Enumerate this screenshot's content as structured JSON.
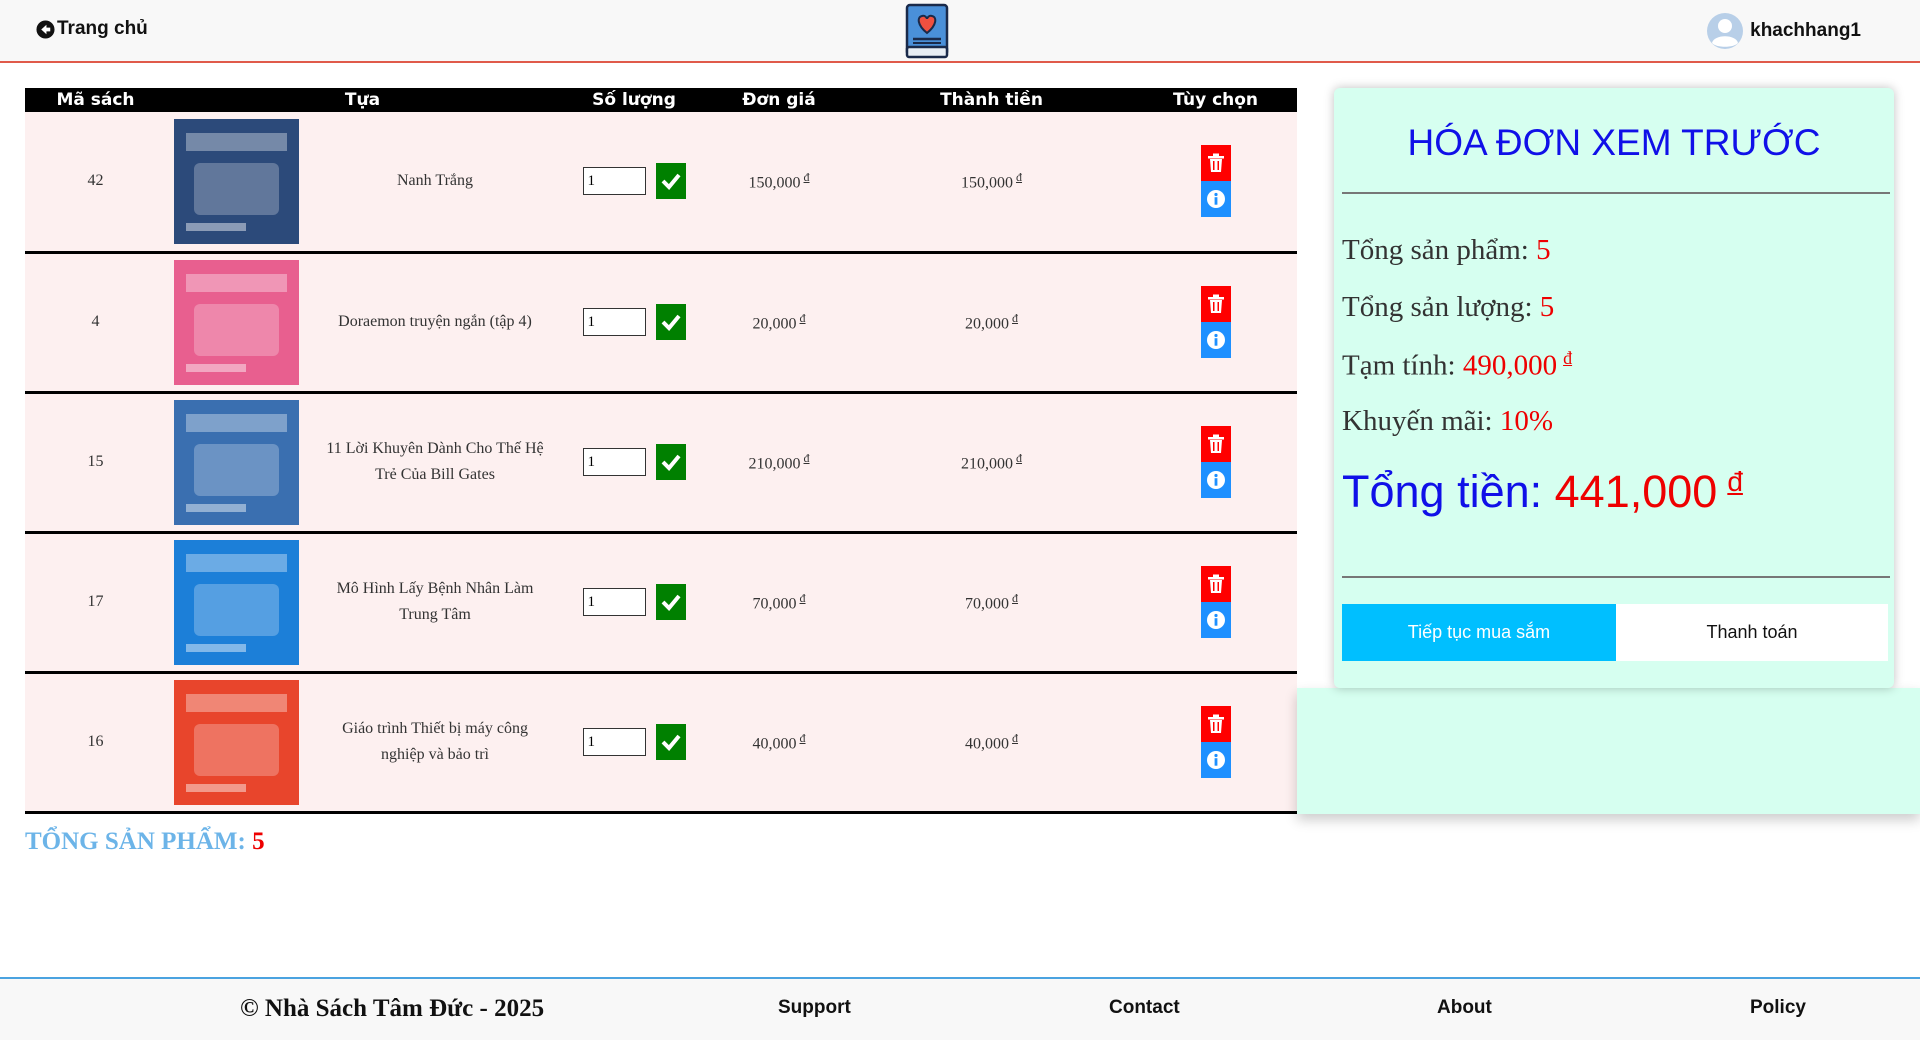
{
  "header": {
    "home_label": "Trang chủ",
    "username": "khachhang1"
  },
  "table": {
    "columns": [
      "Mã sách",
      "Tựa",
      "Số lượng",
      "Đơn giá",
      "Thành tiền",
      "Tùy chọn"
    ],
    "currency": "đ",
    "rows": [
      {
        "id": "42",
        "title": "Nanh Trắng",
        "qty": "1",
        "price": "150,000",
        "total": "150,000",
        "cover_color": "#2c4a7a"
      },
      {
        "id": "4",
        "title": "Doraemon truyện ngắn (tập 4)",
        "qty": "1",
        "price": "20,000",
        "total": "20,000",
        "cover_color": "#e85f8f"
      },
      {
        "id": "15",
        "title": "11 Lời Khuyên Dành Cho Thế Hệ Trẻ Của Bill Gates",
        "qty": "1",
        "price": "210,000",
        "total": "210,000",
        "cover_color": "#3a6fb0"
      },
      {
        "id": "17",
        "title": "Mô Hình Lấy Bệnh Nhân Làm Trung Tâm",
        "qty": "1",
        "price": "70,000",
        "total": "70,000",
        "cover_color": "#1c7fd8"
      },
      {
        "id": "16",
        "title": "Giáo trình Thiết bị máy công nghiệp và bảo trì",
        "qty": "1",
        "price": "40,000",
        "total": "40,000",
        "cover_color": "#e8452c"
      }
    ]
  },
  "summary": {
    "total_label": "TỔNG SẢN PHẨM:",
    "total_value": "5"
  },
  "invoice": {
    "title": "HÓA ĐƠN XEM TRƯỚC",
    "products_label": "Tổng sản phẩm:",
    "products_value": "5",
    "quantity_label": "Tổng sản lượng:",
    "quantity_value": "5",
    "subtotal_label": "Tạm tính:",
    "subtotal_value": "490,000",
    "discount_label": "Khuyến mãi:",
    "discount_value": "10%",
    "grand_label": "Tổng tiền:",
    "grand_value": "441,000",
    "currency": "đ",
    "continue_label": "Tiếp tục mua sắm",
    "pay_label": "Thanh toán"
  },
  "footer": {
    "copyright": "© Nhà Sách Tâm Đức - 2025",
    "links": [
      "Support",
      "Contact",
      "About",
      "Policy"
    ]
  },
  "colors": {
    "accent_blue": "#1010e8",
    "price_red": "#e00000",
    "panel_bg": "#d6fff0",
    "row_bg": "#fdf0f0",
    "continue_btn": "#00bfff",
    "check_green": "#008000",
    "delete_red": "#ff0000",
    "info_blue": "#1e90ff"
  }
}
